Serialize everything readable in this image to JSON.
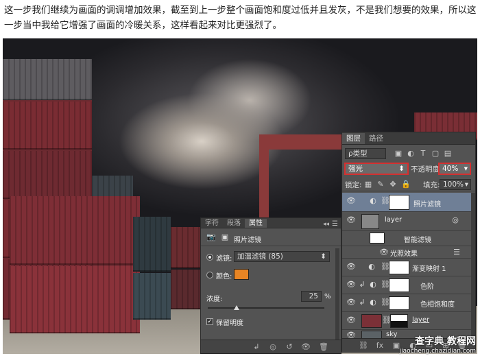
{
  "intro_text": "这一步我们继续为画面的调调增加效果，截至到上一步整个画面饱和度过低并且发灰，不是我们想要的效果，所以这一步当中我给它增强了画面的冷暖关系，这样看起来对比更强烈了。",
  "layers_panel": {
    "tabs": [
      "图层",
      "路径"
    ],
    "kind_filter": "ρ类型",
    "blend_mode": "强光",
    "opacity_label": "不透明度:",
    "opacity_value": "40%",
    "lock_label": "锁定:",
    "fill_label": "填充:",
    "fill_value": "100%",
    "layers": [
      {
        "name": "照片滤镜",
        "type": "adjustment",
        "selected": true
      },
      {
        "name": "layer",
        "type": "smart-object"
      },
      {
        "name": "智能滤镜",
        "type": "smart-filters"
      },
      {
        "name": "光照效果",
        "type": "filter"
      },
      {
        "name": "渐变映射 1",
        "type": "adjustment"
      },
      {
        "name": "色阶",
        "type": "adjustment"
      },
      {
        "name": "色相饱和度",
        "type": "adjustment"
      },
      {
        "name": "layer",
        "type": "masked-image"
      },
      {
        "name": "sky",
        "type": "image"
      }
    ],
    "bottom_icons": [
      "link-icon",
      "fx-icon",
      "mask-icon",
      "adjustment-icon",
      "folder-icon",
      "new-layer-icon",
      "trash-icon"
    ]
  },
  "properties_panel": {
    "tabs": [
      "字符",
      "段落",
      "属性"
    ],
    "title": "照片滤镜",
    "filter_label": "滤镜:",
    "filter_value": "加温滤镜 (85)",
    "color_label": "颜色:",
    "color_swatch": "#e88524",
    "density_label": "浓度:",
    "density_value": "25",
    "density_unit": "%",
    "preserve_label": "保留明度",
    "preserve_checked": true,
    "bottom_icons": [
      "clip-icon",
      "view-previous-icon",
      "reset-icon",
      "visibility-icon",
      "trash-icon"
    ]
  },
  "watermark": {
    "brand": "查字典 教程网",
    "url": "jiaocheng.chazidian.com"
  }
}
